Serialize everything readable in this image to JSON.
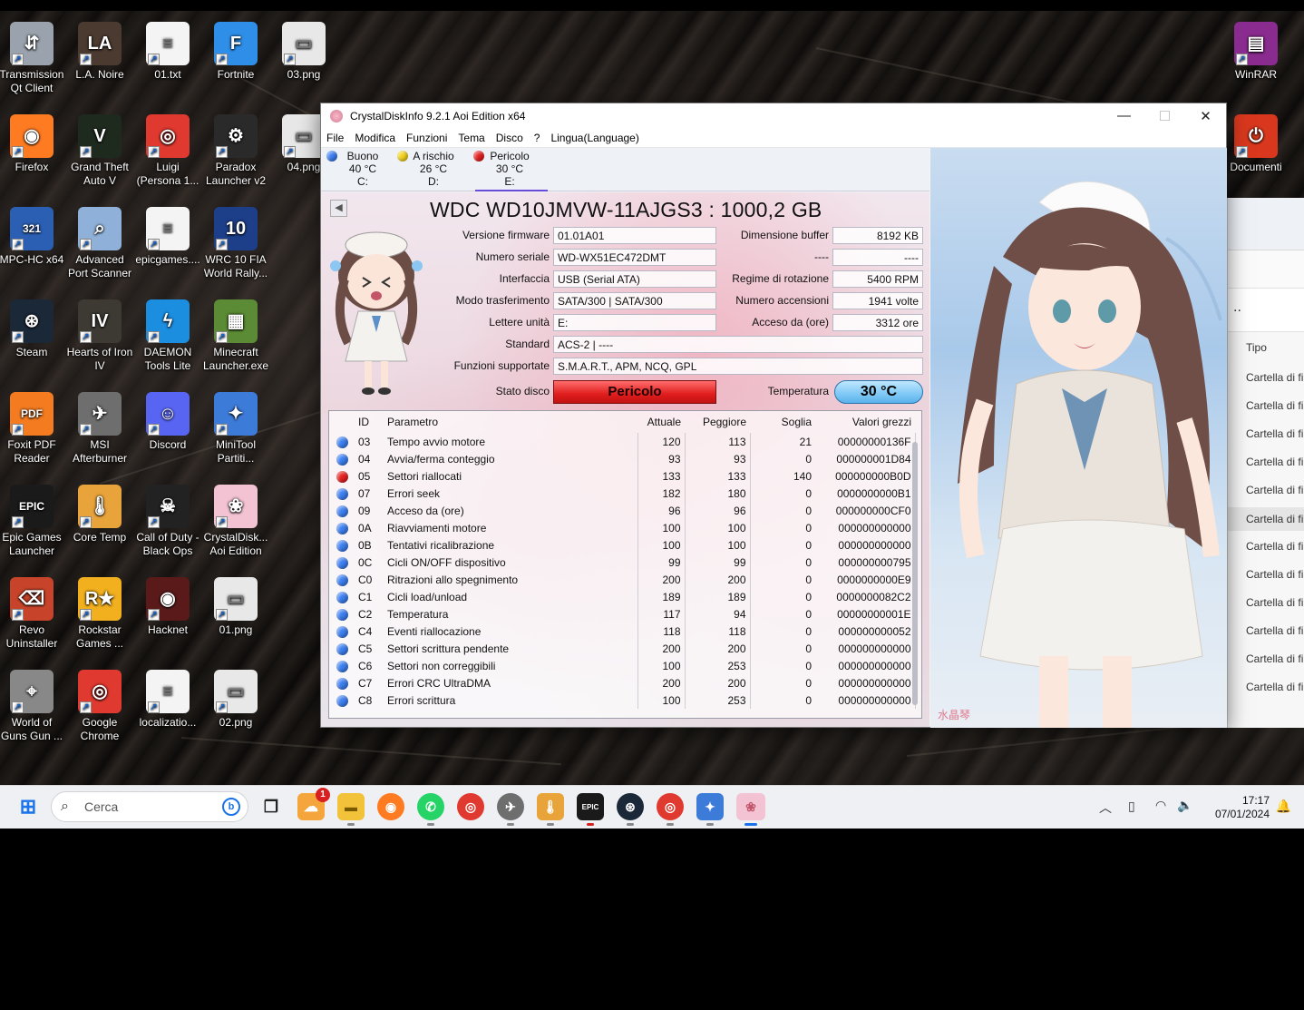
{
  "desktop": {
    "icons": [
      {
        "label": "Transmission Qt Client",
        "glyph": "⇵",
        "color": "#9aa3ad"
      },
      {
        "label": "L.A. Noire",
        "glyph": "LA",
        "color": "#4a3a30"
      },
      {
        "label": "01.txt",
        "glyph": "≡",
        "color": "#f4f4f4"
      },
      {
        "label": "Fortnite",
        "glyph": "F",
        "color": "#2e8ee8"
      },
      {
        "label": "03.png",
        "glyph": "▭",
        "color": "#e8e8e8"
      },
      {
        "label": "Firefox",
        "glyph": "◉",
        "color": "#ff7b22"
      },
      {
        "label": "Grand Theft Auto V",
        "glyph": "V",
        "color": "#1f2a1f"
      },
      {
        "label": "Luigi (Persona 1...",
        "glyph": "◎",
        "color": "#e0392f"
      },
      {
        "label": "Paradox Launcher v2",
        "glyph": "⚙",
        "color": "#2a2a2a"
      },
      {
        "label": "04.png",
        "glyph": "▭",
        "color": "#e8e8e8"
      },
      {
        "label": "MPC-HC x64",
        "glyph": "321",
        "color": "#2b5fb4"
      },
      {
        "label": "Advanced Port Scanner",
        "glyph": "⌕",
        "color": "#8fb0d8"
      },
      {
        "label": "epicgames....",
        "glyph": "≡",
        "color": "#f4f4f4"
      },
      {
        "label": "WRC 10 FIA World Rally...",
        "glyph": "10",
        "color": "#1d3f8a"
      },
      {
        "label": "Steam",
        "glyph": "⊛",
        "color": "#1b2838"
      },
      {
        "label": "Hearts of Iron IV",
        "glyph": "IV",
        "color": "#3d3a33"
      },
      {
        "label": "DAEMON Tools Lite",
        "glyph": "ϟ",
        "color": "#1c8ee0"
      },
      {
        "label": "Minecraft Launcher.exe",
        "glyph": "▦",
        "color": "#5b8b34"
      },
      {
        "label": "Foxit PDF Reader",
        "glyph": "PDF",
        "color": "#f47b20"
      },
      {
        "label": "MSI Afterburner",
        "glyph": "✈",
        "color": "#6e6e6e"
      },
      {
        "label": "Discord",
        "glyph": "☺",
        "color": "#5865f2"
      },
      {
        "label": "MiniTool Partiti...",
        "glyph": "✦",
        "color": "#3d7bd9"
      },
      {
        "label": "Epic Games Launcher",
        "glyph": "EPIC",
        "color": "#1a1a1a"
      },
      {
        "label": "Core Temp",
        "glyph": "🌡",
        "color": "#e8a33a"
      },
      {
        "label": "Call of Duty - Black Ops",
        "glyph": "☠",
        "color": "#222"
      },
      {
        "label": "CrystalDisk... Aoi Edition",
        "glyph": "❀",
        "color": "#f3c3d3"
      },
      {
        "label": "Revo Uninstaller",
        "glyph": "⌫",
        "color": "#c7442a"
      },
      {
        "label": "Rockstar Games ...",
        "glyph": "R★",
        "color": "#f2b01e"
      },
      {
        "label": "Hacknet",
        "glyph": "◉",
        "color": "#5a1a1a"
      },
      {
        "label": "01.png",
        "glyph": "▭",
        "color": "#e8e8e8"
      },
      {
        "label": "World of Guns Gun ...",
        "glyph": "⌖",
        "color": "#888"
      },
      {
        "label": "Google Chrome",
        "glyph": "◎",
        "color": "#e0392f"
      },
      {
        "label": "localizatio...",
        "glyph": "≡",
        "color": "#f4f4f4"
      },
      {
        "label": "02.png",
        "glyph": "▭",
        "color": "#e8e8e8"
      },
      {
        "label": "WinRAR",
        "glyph": "▤",
        "color": "#8a2b8f"
      },
      {
        "label": "Documenti",
        "glyph": "⏻",
        "color": "#d9381e"
      }
    ]
  },
  "window": {
    "title": "CrystalDiskInfo 9.2.1 Aoi Edition x64",
    "menu": [
      "File",
      "Modifica",
      "Funzioni",
      "Tema",
      "Disco",
      "?",
      "Lingua(Language)"
    ],
    "drives": [
      {
        "status": "Buono",
        "temp": "40 °C",
        "letter": "C:",
        "color": "#3b7ef0"
      },
      {
        "status": "A rischio",
        "temp": "26 °C",
        "letter": "D:",
        "color": "#f2d21b"
      },
      {
        "status": "Pericolo",
        "temp": "30 °C",
        "letter": "E:",
        "color": "#e52020"
      }
    ],
    "model": "WDC WD10JMVW-11AJGS3 : 1000,2 GB",
    "labels": {
      "firmware": "Versione firmware",
      "serial": "Numero seriale",
      "interface": "Interfaccia",
      "transfer": "Modo trasferimento",
      "letters": "Lettere unità",
      "standard": "Standard",
      "features": "Funzioni supportate",
      "health": "Stato disco",
      "buffer": "Dimensione buffer",
      "blank": "----",
      "rotation": "Regime di rotazione",
      "power_count": "Numero accensioni",
      "power_hours": "Acceso da (ore)",
      "temperature": "Temperatura"
    },
    "values": {
      "firmware": "01.01A01",
      "serial": "WD-WX51EC472DMT",
      "interface": "USB (Serial ATA)",
      "transfer": "SATA/300 | SATA/300",
      "letters": "E:",
      "standard": "ACS-2 | ----",
      "features": "S.M.A.R.T., APM, NCQ, GPL",
      "health": "Pericolo",
      "buffer": "8192 KB",
      "blank": "----",
      "rotation": "5400 RPM",
      "power_count": "1941 volte",
      "power_hours": "3312 ore",
      "temperature": "30 °C"
    },
    "smart_headers": [
      "ID",
      "Parametro",
      "Attuale",
      "Peggiore",
      "Soglia",
      "Valori grezzi"
    ],
    "smart_rows": [
      {
        "state": "good",
        "id": "03",
        "name": "Tempo avvio motore",
        "cur": "120",
        "worst": "113",
        "thr": "21",
        "raw": "00000000136F"
      },
      {
        "state": "good",
        "id": "04",
        "name": "Avvia/ferma conteggio",
        "cur": "93",
        "worst": "93",
        "thr": "0",
        "raw": "000000001D84"
      },
      {
        "state": "bad",
        "id": "05",
        "name": "Settori riallocati",
        "cur": "133",
        "worst": "133",
        "thr": "140",
        "raw": "000000000B0D"
      },
      {
        "state": "good",
        "id": "07",
        "name": "Errori seek",
        "cur": "182",
        "worst": "180",
        "thr": "0",
        "raw": "0000000000B1"
      },
      {
        "state": "good",
        "id": "09",
        "name": "Acceso da (ore)",
        "cur": "96",
        "worst": "96",
        "thr": "0",
        "raw": "000000000CF0"
      },
      {
        "state": "good",
        "id": "0A",
        "name": "Riavviamenti motore",
        "cur": "100",
        "worst": "100",
        "thr": "0",
        "raw": "000000000000"
      },
      {
        "state": "good",
        "id": "0B",
        "name": "Tentativi ricalibrazione",
        "cur": "100",
        "worst": "100",
        "thr": "0",
        "raw": "000000000000"
      },
      {
        "state": "good",
        "id": "0C",
        "name": "Cicli ON/OFF dispositivo",
        "cur": "99",
        "worst": "99",
        "thr": "0",
        "raw": "000000000795"
      },
      {
        "state": "good",
        "id": "C0",
        "name": "Ritrazioni allo spegnimento",
        "cur": "200",
        "worst": "200",
        "thr": "0",
        "raw": "0000000000E9"
      },
      {
        "state": "good",
        "id": "C1",
        "name": "Cicli load/unload",
        "cur": "189",
        "worst": "189",
        "thr": "0",
        "raw": "0000000082C2"
      },
      {
        "state": "good",
        "id": "C2",
        "name": "Temperatura",
        "cur": "117",
        "worst": "94",
        "thr": "0",
        "raw": "00000000001E"
      },
      {
        "state": "good",
        "id": "C4",
        "name": "Eventi riallocazione",
        "cur": "118",
        "worst": "118",
        "thr": "0",
        "raw": "000000000052"
      },
      {
        "state": "good",
        "id": "C5",
        "name": "Settori scrittura pendente",
        "cur": "200",
        "worst": "200",
        "thr": "0",
        "raw": "000000000000"
      },
      {
        "state": "good",
        "id": "C6",
        "name": "Settori non correggibili",
        "cur": "100",
        "worst": "253",
        "thr": "0",
        "raw": "000000000000"
      },
      {
        "state": "good",
        "id": "C7",
        "name": "Errori CRC UltraDMA",
        "cur": "200",
        "worst": "200",
        "thr": "0",
        "raw": "000000000000"
      },
      {
        "state": "good",
        "id": "C8",
        "name": "Errori scrittura",
        "cur": "100",
        "worst": "253",
        "thr": "0",
        "raw": "000000000000"
      }
    ],
    "art_signature": "水晶琴"
  },
  "background_window": {
    "header_fragment": "..",
    "column": "Tipo",
    "items": [
      "Cartella di fi",
      "Cartella di fi",
      "Cartella di fi",
      "Cartella di fi",
      "Cartella di fi",
      "Cartella di fi",
      "Cartella di fi",
      "Cartella di fi",
      "Cartella di fi",
      "Cartella di fi",
      "Cartella di fi",
      "Cartella di fi"
    ]
  },
  "taskbar": {
    "search_placeholder": "Cerca",
    "badge_count": "1",
    "time": "17:17",
    "date": "07/01/2024"
  },
  "colors": {
    "good": "#3b7ef0",
    "bad": "#e52020",
    "danger_box": "#e01d1d",
    "temp_box": "#7fc8f5"
  }
}
